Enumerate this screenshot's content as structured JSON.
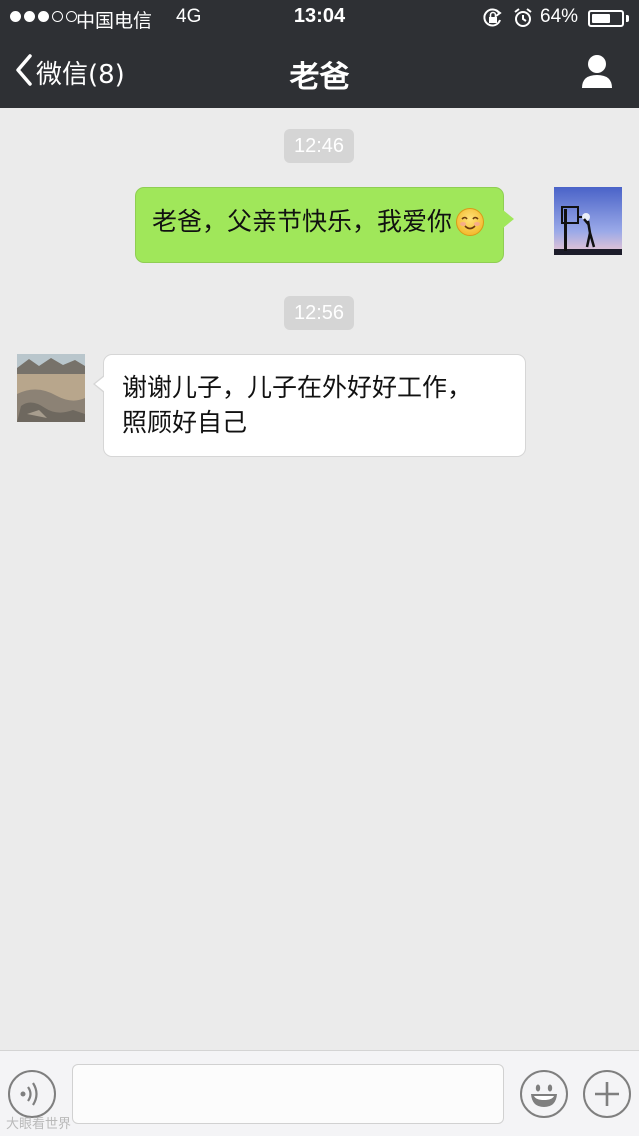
{
  "status_bar": {
    "carrier": "中国电信",
    "network": "4G",
    "time": "13:04",
    "battery_percent": "64%",
    "battery_level": 0.64,
    "signal_filled": 3,
    "signal_total": 5,
    "icons": [
      "rotation-lock-icon",
      "alarm-icon",
      "battery-icon"
    ]
  },
  "nav": {
    "back_label": "微信(8)",
    "title": "老爸",
    "right_icon": "person-icon"
  },
  "messages": [
    {
      "time": "12:46"
    },
    {
      "direction": "outgoing",
      "text": "老爸，父亲节快乐，我爱你",
      "emoji": "smiling-face-emoji",
      "avatar": "basketball-silhouette-avatar"
    },
    {
      "time": "12:56"
    },
    {
      "direction": "incoming",
      "lines": [
        "谢谢儿子，儿子在外好好工作，",
        "照顾好自己"
      ],
      "avatar": "mountain-landscape-avatar"
    }
  ],
  "input_bar": {
    "voice_icon": "voice-icon",
    "text_value": "",
    "emoji_icon": "emoji-icon",
    "more_icon": "plus-icon"
  },
  "watermark": "大眼看世界",
  "colors": {
    "nav_background": "#2e3034",
    "chat_background": "#ebebeb",
    "outgoing_bubble": "#a0e75a",
    "incoming_bubble": "#ffffff",
    "time_chip": "#d5d5d5"
  }
}
